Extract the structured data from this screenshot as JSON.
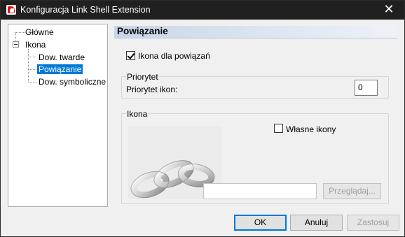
{
  "window": {
    "title": "Konfiguracja Link Shell Extension",
    "close_glyph": "✕"
  },
  "tree": {
    "items": [
      {
        "label": "Główne"
      },
      {
        "label": "Ikona"
      },
      {
        "label": "Dow. twarde"
      },
      {
        "label": "Powiązanie",
        "selected": true
      },
      {
        "label": "Dow. symboliczne"
      }
    ]
  },
  "panel": {
    "header": "Powiązanie",
    "icon_checkbox_label": "Ikona dla powiązań",
    "icon_checkbox_checked": true,
    "priority_group": {
      "legend": "Priorytet",
      "label": "Priorytet ikon:",
      "value": "0"
    },
    "icon_group": {
      "legend": "Ikona",
      "own_icons_label": "Własne ikony",
      "own_icons_checked": false,
      "path_value": "",
      "browse_label": "Przeglądaj..."
    }
  },
  "buttons": {
    "ok": "OK",
    "cancel": "Anuluj",
    "apply": "Zastosuj"
  }
}
